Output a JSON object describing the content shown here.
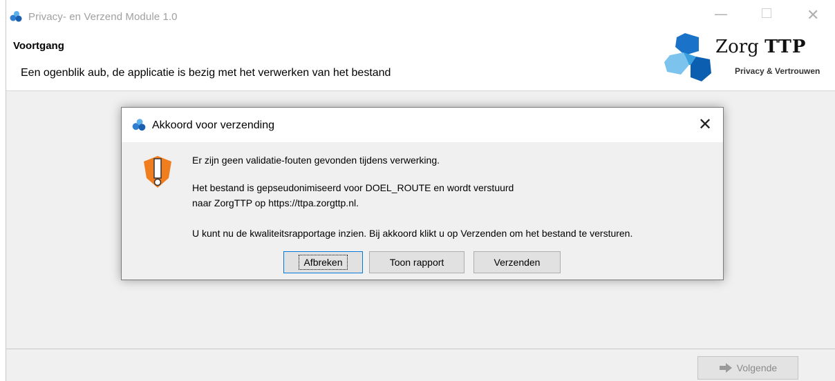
{
  "window": {
    "title": "Privacy- en Verzend Module 1.0",
    "icon": "zorgttp-cluster-icon",
    "controls": {
      "minimize": "—",
      "maximize": "",
      "close": "✕"
    }
  },
  "header": {
    "title": "Voortgang",
    "subtitle": "Een ogenblik aub, de applicatie is bezig met het verwerken van het bestand"
  },
  "logo": {
    "name_regular": "Zorg",
    "name_bold": "TTP",
    "tagline": "Privacy & Vertrouwen",
    "colors": [
      "#1a73c8",
      "#3aa0e0",
      "#7cc4ee",
      "#0b5eb0"
    ]
  },
  "dialog": {
    "title": "Akkoord voor verzending",
    "close": "✕",
    "warning_icon": "warning-shield-icon",
    "messages": {
      "line1": "Er zijn geen validatie-fouten gevonden tijdens verwerking.",
      "line2": "Het bestand is gepseudonimiseerd voor DOEL_ROUTE en wordt verstuurd",
      "line3": "naar ZorgTTP op https://ttpa.zorgttp.nl.",
      "line4": "U kunt nu de kwaliteitsrapportage inzien. Bij akkoord klikt u op Verzenden om het bestand te versturen."
    },
    "buttons": {
      "abort": "Afbreken",
      "report": "Toon rapport",
      "send": "Verzenden"
    }
  },
  "footer": {
    "next_label": "Volgende",
    "next_enabled": false
  },
  "colors": {
    "warning": "#f07d1e",
    "accent": "#0078d7"
  }
}
